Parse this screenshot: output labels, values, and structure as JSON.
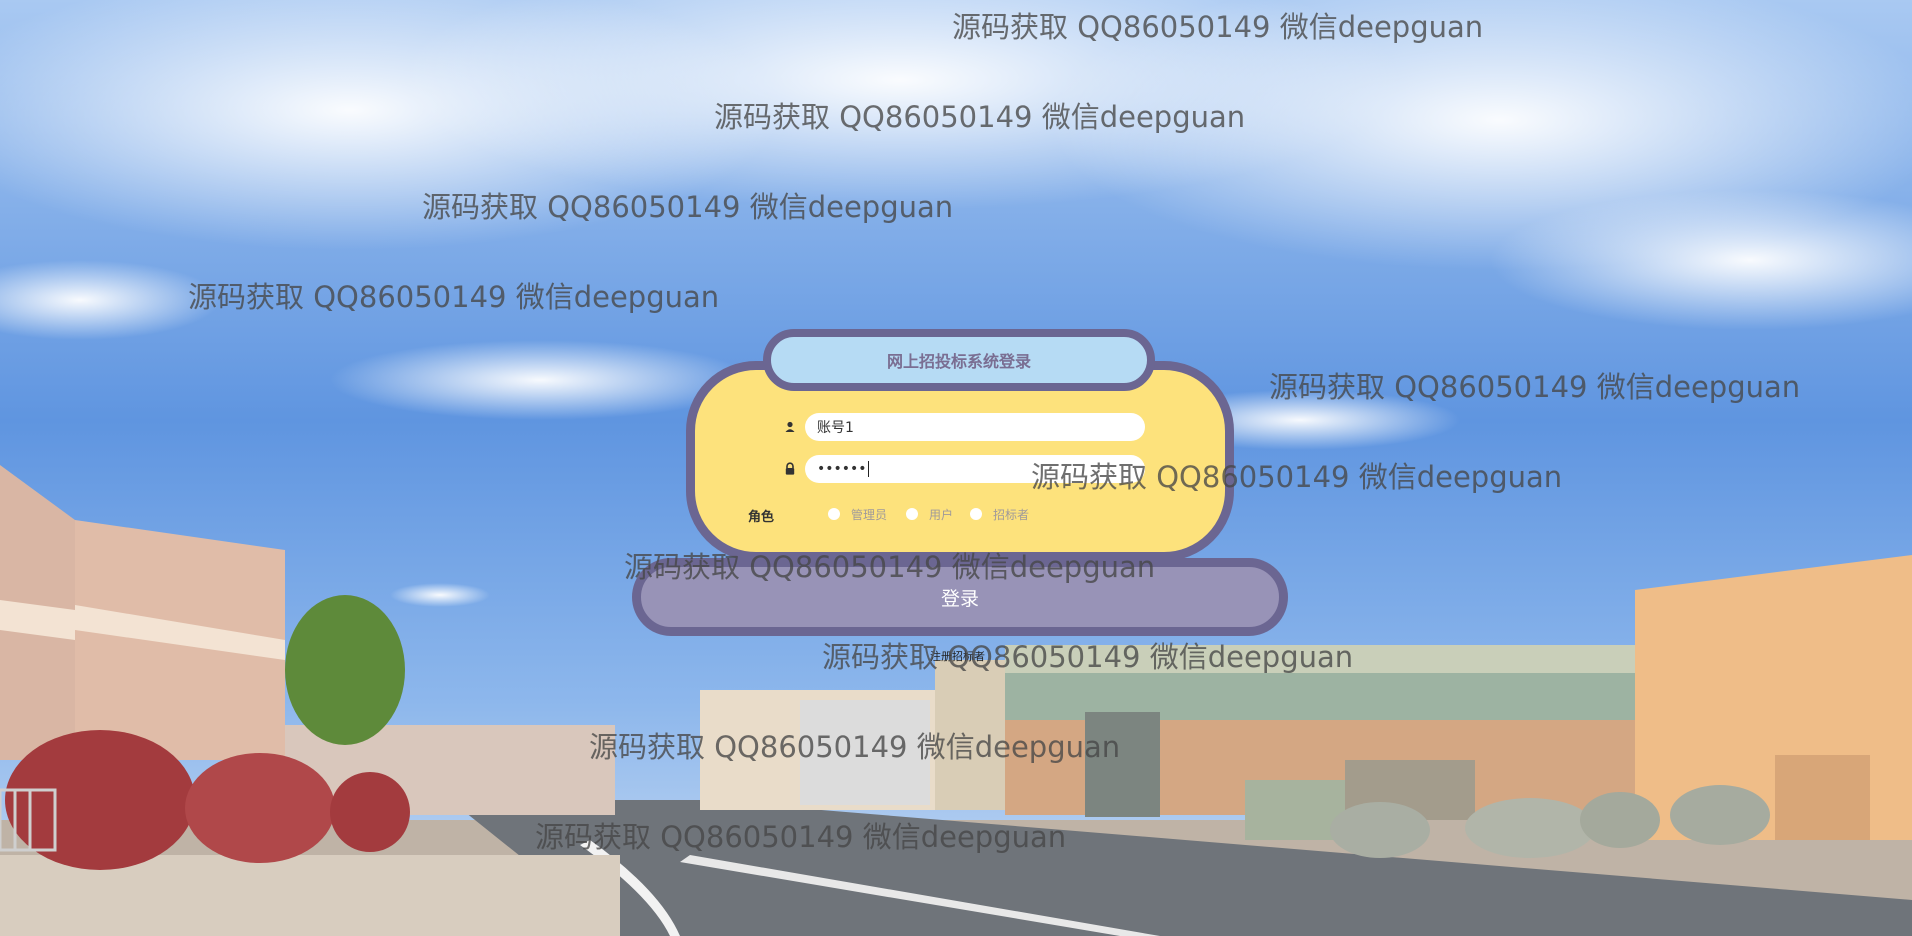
{
  "login": {
    "title": "网上招投标系统登录",
    "username_value": "账号1",
    "password_value": "••••••",
    "role_label": "角色",
    "roles": [
      "管理员",
      "用户",
      "招标者"
    ],
    "login_button": "登录",
    "register_link": "注册招标者"
  },
  "icons": {
    "user": "user-icon",
    "lock": "lock-icon"
  },
  "colors": {
    "card": "#fde27c",
    "border": "#6b6692",
    "title_tab": "#b6dbf4",
    "button": "#9893b7"
  },
  "watermarks": [
    "源码获取 QQ86050149 微信deepguan",
    "源码获取 QQ86050149 微信deepguan",
    "源码获取 QQ86050149 微信deepguan",
    "源码获取 QQ86050149 微信deepguan",
    "源码获取 QQ86050149 微信deepguan",
    "源码获取 QQ86050149 微信deepguan",
    "源码获取 QQ86050149 微信deepguan",
    "源码获取 QQ86050149 微信deepguan",
    "源码获取 QQ86050149 微信deepguan",
    "源码获取 QQ86050149 微信deepguan"
  ]
}
